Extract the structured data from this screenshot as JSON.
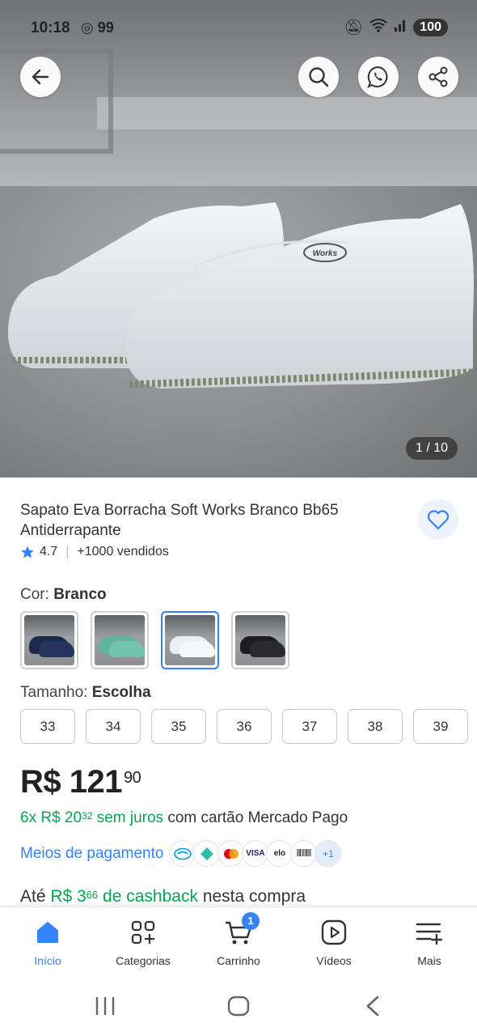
{
  "status_bar": {
    "time": "10:18",
    "notifications": "99",
    "battery": "100"
  },
  "product": {
    "image_counter": "1 / 10",
    "image_logo": "Works",
    "title": "Sapato Eva Borracha Soft Works Branco Bb65 Antiderrapante",
    "rating": "4.7",
    "sold": "+1000 vendidos",
    "color_label": "Cor:",
    "color_value": "Branco",
    "swatches": [
      "Azul marinho",
      "Verde",
      "Branco",
      "Preto"
    ],
    "size_label": "Tamanho:",
    "size_value": "Escolha",
    "sizes": [
      "33",
      "34",
      "35",
      "36",
      "37",
      "38",
      "39"
    ],
    "price_currency": "R$",
    "price_int": "121",
    "price_cents": "90",
    "installments_prefix": "6x R$ 20",
    "installments_cents": "32",
    "installments_terms": "sem juros",
    "installments_suffix": "com cartão Mercado Pago",
    "payment_link": "Meios de pagamento",
    "payment_more": "+1",
    "cashback_prefix": "Até",
    "cashback_value": "R$ 3",
    "cashback_cents": "66",
    "cashback_label": "de cashback",
    "cashback_suffix": "nesta compra"
  },
  "bottom_nav": {
    "items": [
      {
        "label": "Início"
      },
      {
        "label": "Categorias"
      },
      {
        "label": "Carrinho",
        "badge": "1"
      },
      {
        "label": "Vídeos"
      },
      {
        "label": "Mais"
      }
    ]
  },
  "colors": {
    "accent": "#3483fa",
    "green": "#00a650"
  }
}
